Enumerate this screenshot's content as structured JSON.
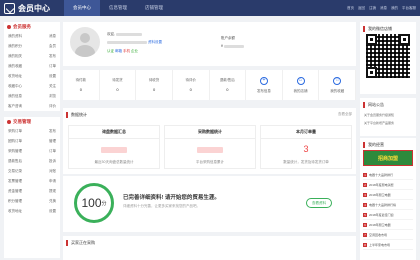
{
  "header": {
    "logo_text": "会员中心",
    "nav": [
      {
        "label": "会员中心",
        "active": true
      },
      {
        "label": "信息管理",
        "active": false
      },
      {
        "label": "店铺管理",
        "active": false
      }
    ],
    "links": [
      "首页",
      "返回",
      "注销",
      "消息",
      "我的",
      "平台客服"
    ]
  },
  "sidebar": {
    "sections": [
      {
        "title": "会员服务",
        "rows": [
          [
            "我的资料",
            "消息"
          ],
          [
            "我的积分",
            "会员"
          ],
          [
            "我的相关",
            "发布"
          ],
          [
            "我的收藏",
            "订单"
          ],
          [
            "收货地址",
            "设置"
          ],
          [
            "收藏中心",
            "关注"
          ],
          [
            "我的信息",
            "浏览"
          ],
          [
            "客户咨询",
            "评价"
          ]
        ]
      },
      {
        "title": "交易管理",
        "rows": [
          [
            "采购订单",
            "发布"
          ],
          [
            "团购订单",
            "管理"
          ],
          [
            "采购管理",
            "订单"
          ],
          [
            "退款售后",
            "投诉"
          ],
          [
            "交易记录",
            "对账"
          ],
          [
            "发票管理",
            "申请"
          ],
          [
            "资金管理",
            "提现"
          ],
          [
            "积分管理",
            "兑换"
          ],
          [
            "收货地址",
            "设置"
          ]
        ]
      }
    ]
  },
  "profile": {
    "greeting": "欢迎,",
    "tags_link": "资料设置",
    "badge_text": "实名",
    "cert_label": "账户余额",
    "cert_value": "¥",
    "verify_items": [
      "认证",
      "邮箱",
      "手机",
      "企业"
    ]
  },
  "stats": [
    {
      "label": "待付款",
      "value": "0",
      "type": "num"
    },
    {
      "label": "待发货",
      "value": "0",
      "type": "num"
    },
    {
      "label": "待收货",
      "value": "0",
      "type": "num"
    },
    {
      "label": "待评价",
      "value": "0",
      "type": "num"
    },
    {
      "label": "退款/售后",
      "value": "0",
      "type": "num"
    },
    {
      "label": "发布信息",
      "value": "+",
      "type": "icon"
    },
    {
      "label": "我的店铺",
      "value": "⌂",
      "type": "icon"
    },
    {
      "label": "我的收藏",
      "value": "☆",
      "type": "icon"
    }
  ],
  "data_stats": {
    "title": "数据统计",
    "more": "查看全部",
    "boxes": [
      {
        "head": "询盘数据汇总",
        "value": "",
        "sub": "最近30天询盘总数量统计"
      },
      {
        "head": "采购数据统计",
        "value": "",
        "sub": "平台采购信息累计"
      },
      {
        "head": "本月订单量",
        "value": "3",
        "sub": "数量统计，发货及待发货订单"
      }
    ]
  },
  "score": {
    "value": "100",
    "unit": "分",
    "title": "已完善详细资料! 请开始您的贸易生涯。",
    "subtitle": "详细资料十分完善，让更多买家来找您的产品吧。",
    "button": "查看资料"
  },
  "purchase": {
    "title": "买家正在采购"
  },
  "right": {
    "qr_title": "我的微信店铺",
    "notice_title": "网站公告",
    "notice_lines": [
      "关于会员服务升级通知",
      "关于平台新增产品服务"
    ],
    "recommend_title": "我的经营",
    "promo_text": "招商加盟",
    "recommend_items": [
      "电器十大品牌排行",
      "2018年度厨电消费",
      "2018年厨卫电器",
      "电器十大品牌排行榜",
      "2018年度最佳门窗",
      "2018年厨卫电器",
      "空调回收市场",
      "上半年家电市场"
    ]
  }
}
